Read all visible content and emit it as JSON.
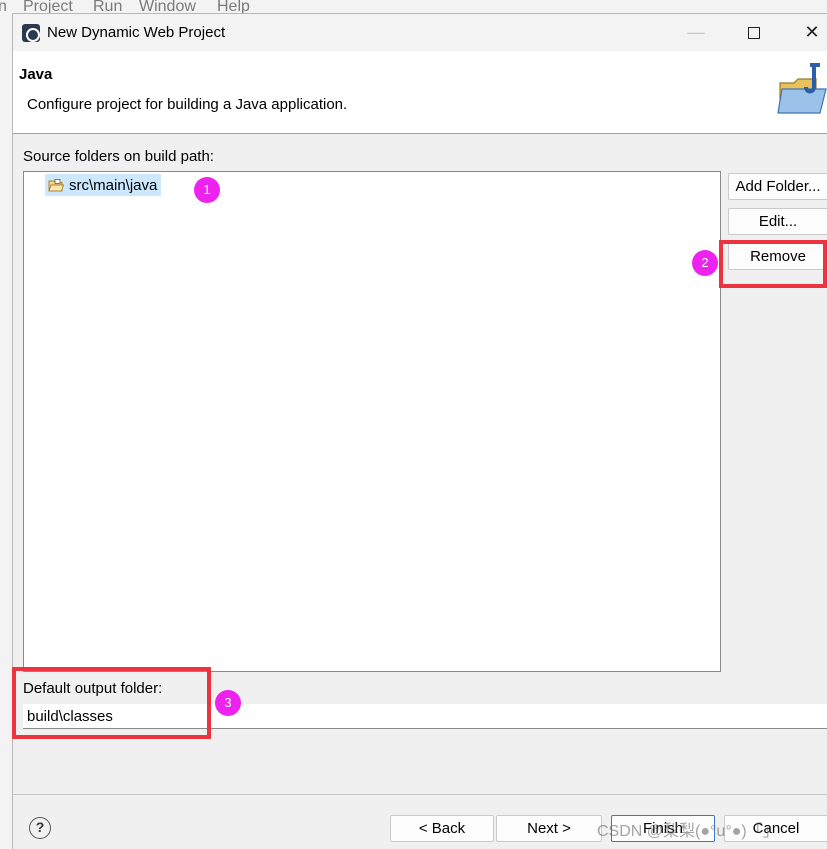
{
  "background_menu": [
    "n",
    "Project",
    "Run",
    "Window",
    "Help"
  ],
  "window": {
    "title": "New Dynamic Web Project",
    "controls": {
      "minimize": "—",
      "maximize": "□",
      "close": "✕"
    }
  },
  "header": {
    "title": "Java",
    "description": "Configure project for building a Java application."
  },
  "source_folders": {
    "label": "Source folders on build path:",
    "items": [
      {
        "label": "src\\main\\java",
        "icon": "package-folder-icon",
        "selected": true
      }
    ]
  },
  "side_buttons": {
    "add_folder": "Add Folder...",
    "edit": "Edit...",
    "remove": "Remove"
  },
  "output_folder": {
    "label": "Default output folder:",
    "value": "build\\classes"
  },
  "footer": {
    "help": "?",
    "back": "< Back",
    "next": "Next >",
    "finish": "Finish",
    "cancel": "Cancel"
  },
  "annotations": {
    "badges": [
      "1",
      "2",
      "3"
    ],
    "color_badge": "#ee22ee",
    "color_box": "#ee3340"
  },
  "watermark": "CSDN @梨梨(●°u°●)「」"
}
